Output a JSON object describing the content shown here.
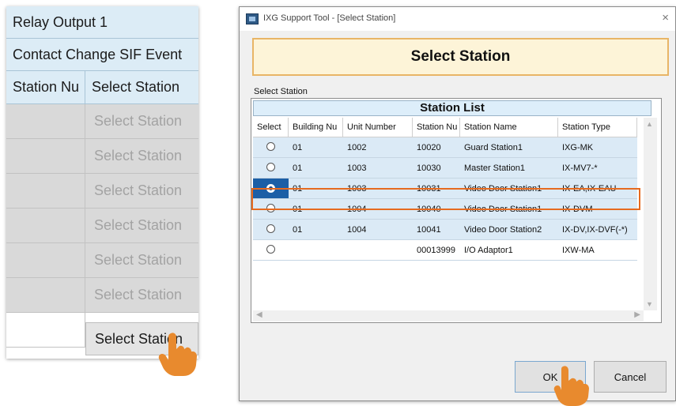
{
  "left_grid": {
    "header1": "Relay Output 1",
    "header2": "Contact Change SIF Event",
    "col_station_number": "Station Nu",
    "col_select_station": "Select Station",
    "rows": [
      {
        "button": "Select Station",
        "state": "disabled"
      },
      {
        "button": "Select Station",
        "state": "disabled"
      },
      {
        "button": "Select Station",
        "state": "disabled"
      },
      {
        "button": "Select Station",
        "state": "disabled"
      },
      {
        "button": "Select Station",
        "state": "disabled"
      },
      {
        "button": "Select Station",
        "state": "disabled"
      },
      {
        "button": "Select Station",
        "state": "active"
      }
    ]
  },
  "dialog": {
    "title": "IXG Support Tool - [Select Station]",
    "close_glyph": "×",
    "banner": "Select Station",
    "section_label": "Select Station",
    "list_title": "Station List",
    "columns": [
      "Select",
      "Building Nu",
      "Unit Number",
      "Station Nu",
      "Station Name",
      "Station Type"
    ],
    "rows": [
      {
        "selected": false,
        "building": "01",
        "unit": "1002",
        "station_no": "10020",
        "name": "Guard Station1",
        "type": "IXG-MK"
      },
      {
        "selected": false,
        "building": "01",
        "unit": "1003",
        "station_no": "10030",
        "name": "Master Station1",
        "type": "IX-MV7-*"
      },
      {
        "selected": true,
        "building": "01",
        "unit": "1003",
        "station_no": "10031",
        "name": "Video Door Station1",
        "type": "IX-EA,IX-EAU"
      },
      {
        "selected": false,
        "building": "01",
        "unit": "1004",
        "station_no": "10040",
        "name": "Video Door Station1",
        "type": "IX-DVM"
      },
      {
        "selected": false,
        "building": "01",
        "unit": "1004",
        "station_no": "10041",
        "name": "Video Door Station2",
        "type": "IX-DV,IX-DVF(-*)"
      },
      {
        "selected": false,
        "building": "",
        "unit": "",
        "station_no": "00013999",
        "name": "I/O Adaptor1",
        "type": "IXW-MA"
      }
    ],
    "ok_label": "OK",
    "cancel_label": "Cancel"
  },
  "colors": {
    "accent_highlight": "#e66a1f",
    "selection": "#1c5fa6",
    "row_fill": "#dbeaf6",
    "banner_fill": "#fdf4d8",
    "hand_cursor": "#e88a2e"
  },
  "icons": [
    "hand-pointer-icon",
    "app-icon",
    "close-icon",
    "radio-button",
    "scroll-up-icon",
    "scroll-down-icon",
    "scroll-left-icon",
    "scroll-right-icon"
  ]
}
